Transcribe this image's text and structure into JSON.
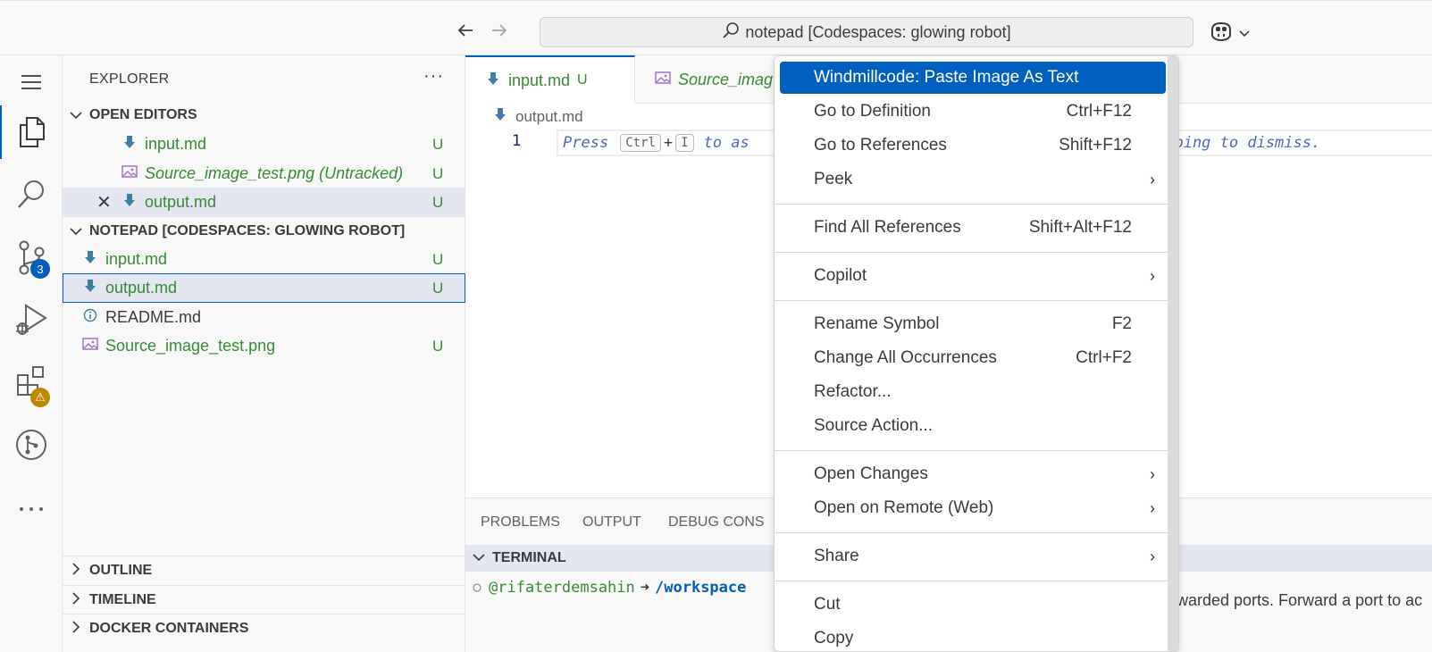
{
  "titlebar": {
    "back_icon": "arrow-left-icon",
    "forward_icon": "arrow-right-icon",
    "command_center": "notepad [Codespaces: glowing robot]",
    "copilot_icon": "copilot-icon"
  },
  "activitybar": {
    "items": [
      "menu-icon",
      "files-icon",
      "search-icon",
      "source-control-icon",
      "run-debug-icon",
      "extensions-icon",
      "remote-icon",
      "more-icon"
    ],
    "source_control_badge": "3",
    "extensions_badge": "⚠"
  },
  "sidebar": {
    "title": "EXPLORER",
    "more": "···",
    "open_editors": {
      "header": "OPEN EDITORS",
      "items": [
        {
          "name": "input.md",
          "status": "U"
        },
        {
          "name": "Source_image_test.png (Untracked)",
          "status": "U"
        },
        {
          "name": "output.md",
          "status": "U"
        }
      ]
    },
    "workspace": {
      "header": "NOTEPAD [CODESPACES: GLOWING ROBOT]",
      "items": [
        {
          "name": "input.md",
          "status": "U"
        },
        {
          "name": "output.md",
          "status": "U"
        },
        {
          "name": "README.md",
          "status": ""
        },
        {
          "name": "Source_image_test.png",
          "status": "U"
        }
      ]
    },
    "outline": "OUTLINE",
    "timeline": "TIMELINE",
    "docker": "DOCKER CONTAINERS"
  },
  "editor": {
    "tabs": [
      {
        "label": "input.md",
        "status": "U"
      },
      {
        "label": "Source_imag"
      }
    ],
    "breadcrumb": "output.md",
    "line_number": "1",
    "hint": {
      "press": "Press",
      "key1": "Ctrl",
      "plus": "+",
      "key2": "I",
      "to_ask": "to as",
      "tail": "typing to dismiss."
    }
  },
  "panel": {
    "tabs": [
      "PROBLEMS",
      "OUTPUT",
      "DEBUG CONS"
    ],
    "terminal_header": "TERMINAL",
    "prompt_user": "@rifaterdemsahin",
    "prompt_arrow": "➜",
    "prompt_path": "/workspace",
    "notice": "warded ports. Forward a port to ac"
  },
  "context_menu": {
    "items": [
      {
        "label": "Windmillcode: Paste Image As Text",
        "shortcut": "",
        "submenu": false
      },
      {
        "label": "Go to Definition",
        "shortcut": "Ctrl+F12",
        "submenu": false
      },
      {
        "label": "Go to References",
        "shortcut": "Shift+F12",
        "submenu": false
      },
      {
        "label": "Peek",
        "shortcut": "",
        "submenu": true
      },
      {
        "label": "Find All References",
        "shortcut": "Shift+Alt+F12",
        "submenu": false
      },
      {
        "label": "Copilot",
        "shortcut": "",
        "submenu": true
      },
      {
        "label": "Rename Symbol",
        "shortcut": "F2",
        "submenu": false
      },
      {
        "label": "Change All Occurrences",
        "shortcut": "Ctrl+F2",
        "submenu": false
      },
      {
        "label": "Refactor...",
        "shortcut": "",
        "submenu": false
      },
      {
        "label": "Source Action...",
        "shortcut": "",
        "submenu": false
      },
      {
        "label": "Open Changes",
        "shortcut": "",
        "submenu": true
      },
      {
        "label": "Open on Remote (Web)",
        "shortcut": "",
        "submenu": true
      },
      {
        "label": "Share",
        "shortcut": "",
        "submenu": true
      },
      {
        "label": "Cut",
        "shortcut": "",
        "submenu": false
      },
      {
        "label": "Copy",
        "shortcut": "",
        "submenu": false
      }
    ],
    "submenu_glyph": "›"
  },
  "colors": {
    "accent": "#005fb8",
    "menu_highlight": "#0060c0",
    "git_untracked": "#388a34",
    "warning": "#bf8803"
  }
}
